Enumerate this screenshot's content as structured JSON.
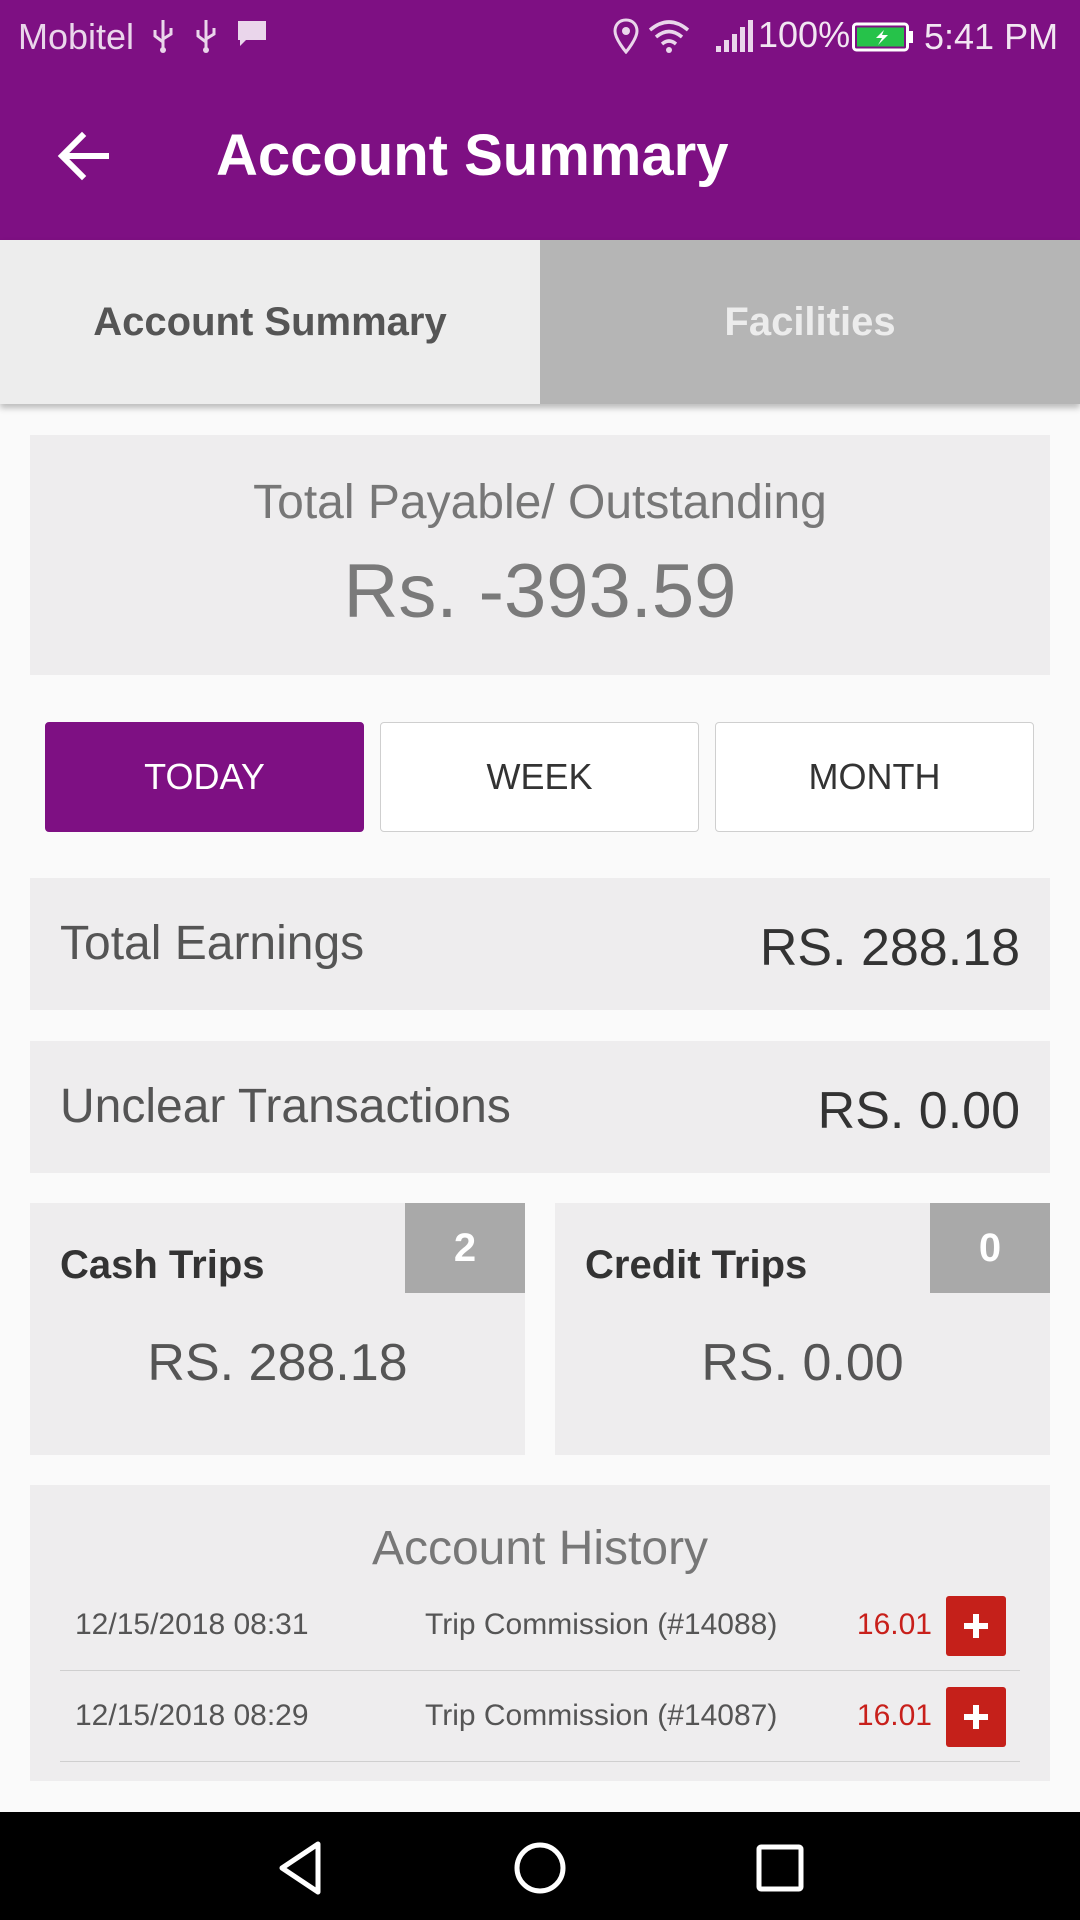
{
  "status_bar": {
    "carrier": "Mobitel",
    "battery": "100%",
    "time": "5:41 PM",
    "icons": [
      "usb-icon",
      "usb-icon",
      "message-icon",
      "location-icon",
      "wifi-icon",
      "signal-icon",
      "battery-icon"
    ]
  },
  "app_bar": {
    "title": "Account Summary",
    "back_icon": "arrow-left-icon"
  },
  "tabs": [
    {
      "label": "Account Summary",
      "active": true
    },
    {
      "label": "Facilities",
      "active": false
    }
  ],
  "summary": {
    "payable_label": "Total Payable/ Outstanding",
    "payable_value": "Rs. -393.59"
  },
  "periods": [
    {
      "label": "TODAY",
      "active": true
    },
    {
      "label": "WEEK",
      "active": false
    },
    {
      "label": "MONTH",
      "active": false
    }
  ],
  "earnings": {
    "label": "Total Earnings",
    "value": "RS. 288.18"
  },
  "unclear": {
    "label": "Unclear Transactions",
    "value": "RS. 0.00"
  },
  "cash_trips": {
    "label": "Cash Trips",
    "count": "2",
    "amount": "RS. 288.18"
  },
  "credit_trips": {
    "label": "Credit Trips",
    "count": "0",
    "amount": "RS. 0.00"
  },
  "history": {
    "title": "Account History",
    "rows": [
      {
        "date": "12/15/2018 08:31",
        "desc": "Trip Commission (#14088)",
        "amount": "16.01"
      },
      {
        "date": "12/15/2018 08:29",
        "desc": "Trip Commission (#14087)",
        "amount": "16.01"
      }
    ]
  },
  "colors": {
    "brand": "#7e1083",
    "negative": "#c8201b"
  }
}
